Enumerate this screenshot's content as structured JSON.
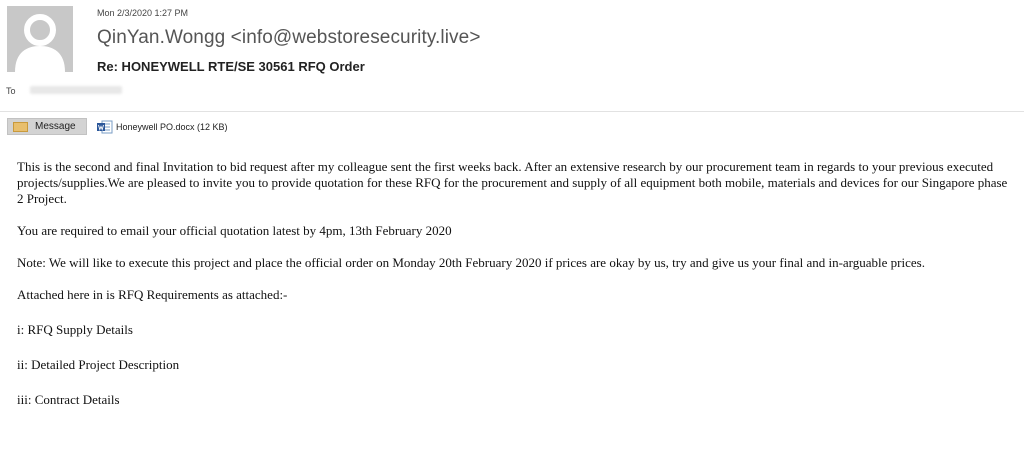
{
  "email": {
    "datetime": "Mon 2/3/2020 1:27 PM",
    "sender": "QinYan.Wongg <info@webstoresecurity.live>",
    "subject": "Re: HONEYWELL RTE/SE 30561 RFQ Order",
    "to_label": "To"
  },
  "attachments": {
    "message_tab": "Message",
    "file": "Honeywell PO.docx (12 KB)"
  },
  "body": {
    "p1": "This is the second and final Invitation to bid request after my colleague sent the first weeks back. After an extensive research by our procurement team in regards to your previous executed projects/supplies.We are pleased to invite you to provide quotation for these RFQ for the procurement and supply of all equipment both mobile, materials and devices for our Singapore phase 2 Project.",
    "p2": "You are required to email your official quotation latest by 4pm, 13th February 2020",
    "p3": "Note: We will like to execute this project and place the official order on Monday 20th February 2020 if prices are okay by us, try and give us your final and in-arguable prices.",
    "p4": "Attached here in is RFQ Requirements as attached:-",
    "item1": "i: RFQ Supply Details",
    "item2": "ii: Detailed Project Description",
    "item3": "iii: Contract Details"
  },
  "colors": {
    "avatar_bg": "#c8c8c8",
    "message_tab_bg": "#d3d3d3",
    "envelope": "#e8bf6e",
    "word_blue": "#2b579a"
  }
}
